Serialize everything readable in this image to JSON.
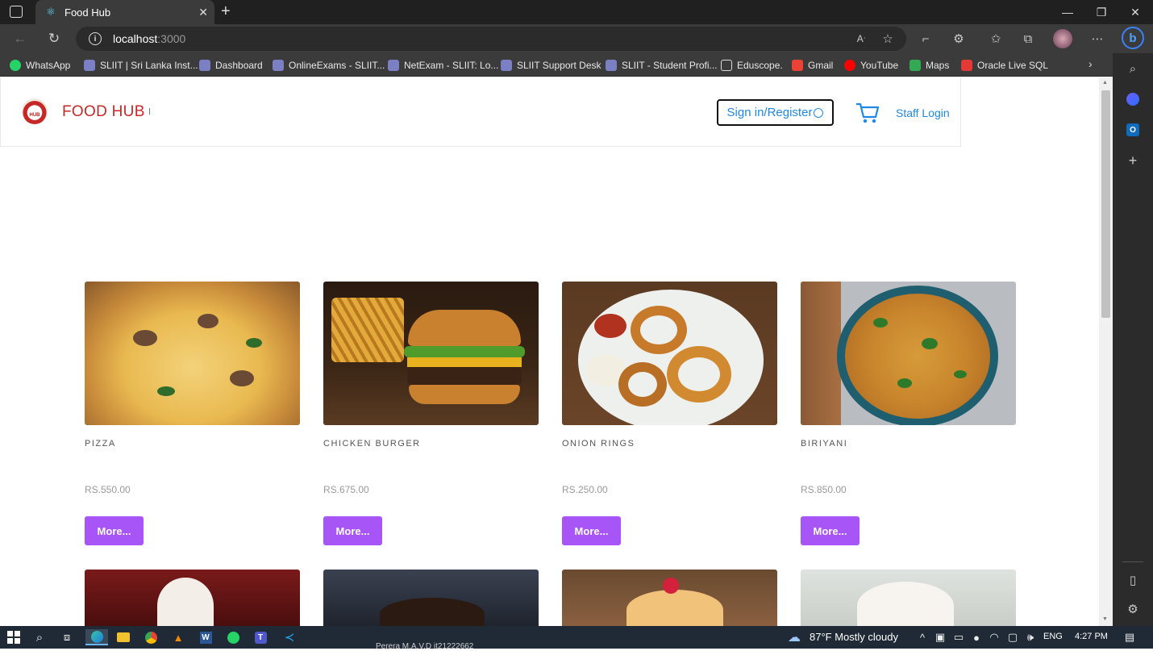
{
  "browser": {
    "tab_title": "Food Hub",
    "url_host": "localhost",
    "url_port": ":3000",
    "bookmarks": [
      {
        "label": "WhatsApp",
        "color": "#25d366"
      },
      {
        "label": "SLIIT | Sri Lanka Inst...",
        "color": "#7b7fc4"
      },
      {
        "label": "Dashboard",
        "color": "#7b7fc4"
      },
      {
        "label": "OnlineExams - SLIIT...",
        "color": "#7b7fc4"
      },
      {
        "label": "NetExam - SLIIT: Lo...",
        "color": "#7b7fc4"
      },
      {
        "label": "SLIIT Support Desk",
        "color": "#7b7fc4"
      },
      {
        "label": "SLIIT - Student Profi...",
        "color": "#7b7fc4"
      },
      {
        "label": "Eduscope.",
        "color": "#dddddd"
      },
      {
        "label": "Gmail",
        "color": "#ea4335"
      },
      {
        "label": "YouTube",
        "color": "#ff0000"
      },
      {
        "label": "Maps",
        "color": "#34a853"
      },
      {
        "label": "Oracle Live SQL",
        "color": "#e53935"
      }
    ]
  },
  "header": {
    "brand": "FOOD HUB",
    "signin_label": "Sign in/Register",
    "staff_login": "Staff Login"
  },
  "products": [
    {
      "name": "PIZZA",
      "price": "RS.550.00",
      "button": "More..."
    },
    {
      "name": "CHICKEN BURGER",
      "price": "RS.675.00",
      "button": "More..."
    },
    {
      "name": "ONION RINGS",
      "price": "RS.250.00",
      "button": "More..."
    },
    {
      "name": "BIRIYANI",
      "price": "RS.850.00",
      "button": "More..."
    }
  ],
  "taskbar": {
    "weather": "87°F  Mostly cloudy",
    "language": "ENG",
    "time": "4:27 PM",
    "teams_preview": "Perera M.A.V.D it21222662"
  },
  "colors": {
    "accent_button": "#a855f7",
    "brand": "#c62828",
    "link": "#1e88e5"
  }
}
